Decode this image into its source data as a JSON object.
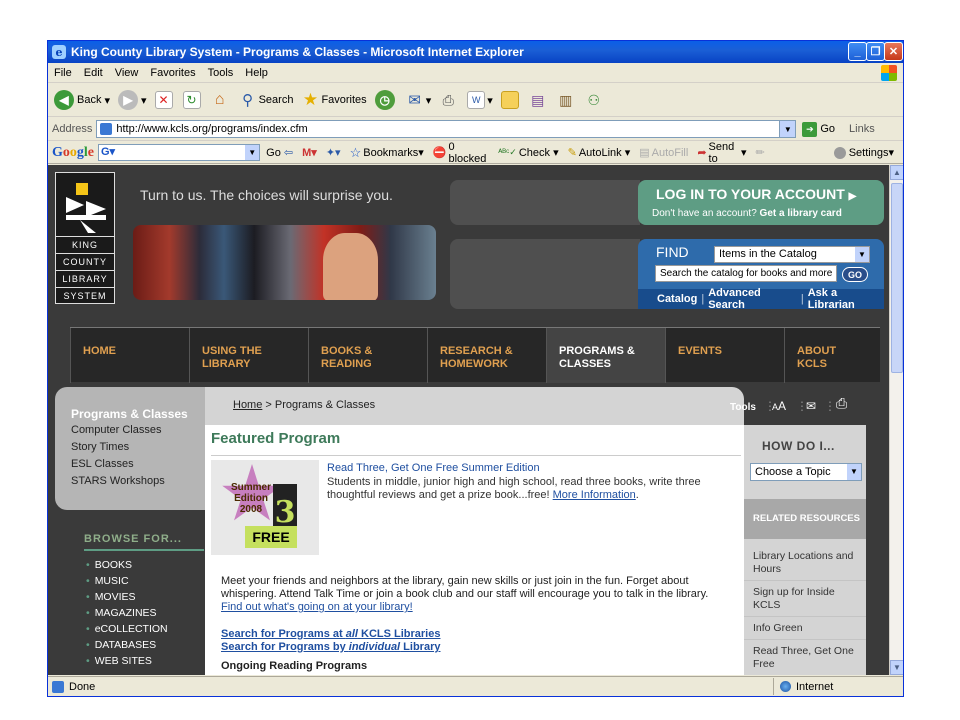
{
  "window": {
    "title": "King County Library System - Programs & Classes - Microsoft Internet Explorer"
  },
  "menu": [
    "File",
    "Edit",
    "View",
    "Favorites",
    "Tools",
    "Help"
  ],
  "toolbar": {
    "back": "Back",
    "search": "Search",
    "favorites": "Favorites"
  },
  "address": {
    "label": "Address",
    "url": "http://www.kcls.org/programs/index.cfm",
    "go": "Go",
    "links": "Links"
  },
  "google": {
    "go": "Go",
    "bookmarks": "Bookmarks",
    "blocked": "0 blocked",
    "check": "Check",
    "autolink": "AutoLink",
    "autofill": "AutoFill",
    "sendto": "Send to",
    "settings": "Settings"
  },
  "status": {
    "left": "Done",
    "zone": "Internet"
  },
  "site": {
    "logo_words": [
      "KING",
      "COUNTY",
      "LIBRARY",
      "SYSTEM"
    ],
    "tagline": "Turn to us. The choices will surprise you.",
    "login": {
      "title": "LOG IN TO YOUR ACCOUNT",
      "sub_text": "Don't have an account?",
      "sub_link": "Get a library card"
    },
    "find": {
      "label": "FIND",
      "select": "Items in the Catalog",
      "placeholder": "Search the catalog for books and more",
      "go": "GO",
      "links": [
        "Catalog",
        "Advanced Search",
        "Ask a Librarian"
      ]
    },
    "nav": [
      {
        "l1": "HOME",
        "l2": ""
      },
      {
        "l1": "USING THE",
        "l2": "LIBRARY"
      },
      {
        "l1": "BOOKS &",
        "l2": "READING"
      },
      {
        "l1": "RESEARCH &",
        "l2": "HOMEWORK"
      },
      {
        "l1": "PROGRAMS &",
        "l2": "CLASSES"
      },
      {
        "l1": "EVENTS",
        "l2": ""
      },
      {
        "l1": "ABOUT",
        "l2": "KCLS"
      }
    ],
    "sidebar": {
      "heading": "Programs & Classes",
      "items": [
        "Computer Classes",
        "Story Times",
        "ESL Classes",
        "STARS Workshops"
      ]
    },
    "browse": {
      "heading": "BROWSE FOR...",
      "items": [
        "BOOKS",
        "MUSIC",
        "MOVIES",
        "MAGAZINES",
        "eCOLLECTION",
        "DATABASES",
        "WEB SITES"
      ]
    },
    "breadcrumb": {
      "home": "Home",
      "sep": ">",
      "current": "Programs & Classes"
    },
    "tools": {
      "label": "Tools"
    },
    "featured": {
      "heading": "Featured Program",
      "title": "Read Three, Get One Free Summer Edition",
      "desc": "Students in middle, junior high and high school, read three books, write three thoughtful reviews and get a prize book...free!",
      "more": "More Information",
      "badge": {
        "line1": "Summer",
        "line2": "Edition",
        "line3": "2008",
        "num": "3",
        "free": "FREE"
      }
    },
    "intro": {
      "text": "Meet your friends and neighbors at the library, gain new skills or just join in the fun. Forget about whispering. Attend Talk Time or join a book club and our staff will encourage you to talk in the library.",
      "link": "Find out what's going on at your library!"
    },
    "search_all": {
      "pre": "Search for Programs at ",
      "em": "all",
      "post": " KCLS Libraries"
    },
    "search_ind": {
      "pre": "Search for Programs by ",
      "em": "individual",
      "post": " Library"
    },
    "ongoing": "Ongoing Reading Programs",
    "howdo": {
      "heading": "HOW DO I...",
      "select": "Choose a Topic"
    },
    "related": {
      "heading": "RELATED RESOURCES",
      "items": [
        "Library Locations and Hours",
        "Sign up for Inside KCLS",
        "Info Green",
        "Read Three, Get One Free"
      ]
    }
  }
}
